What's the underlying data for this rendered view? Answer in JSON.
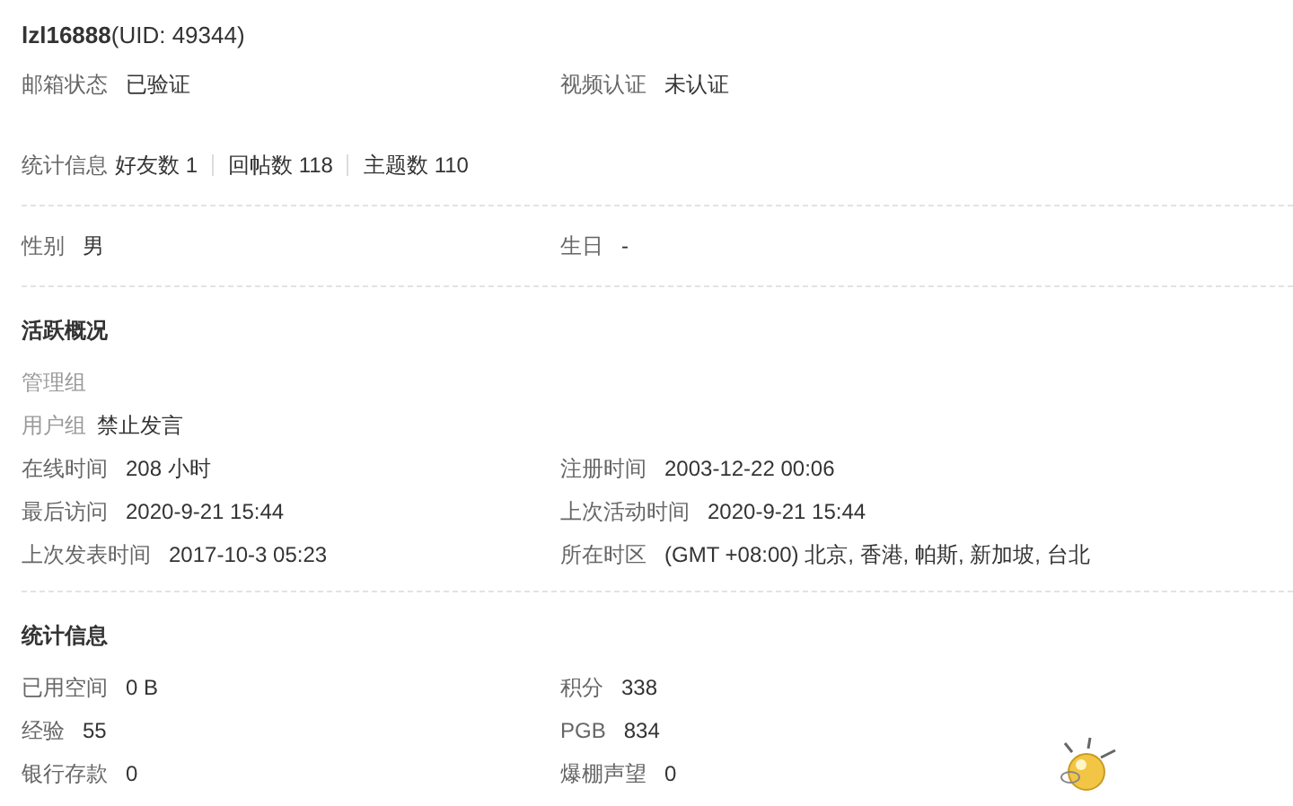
{
  "profile": {
    "username": "lzl16888",
    "uid": "(UID: 49344)"
  },
  "verification": [
    {
      "label": "邮箱状态",
      "value": "已验证"
    },
    {
      "label": "视频认证",
      "value": "未认证"
    }
  ],
  "stats_line": {
    "label": "统计信息",
    "items": [
      "好友数 1",
      "回帖数 118",
      "主题数 110"
    ]
  },
  "personal": [
    {
      "label": "性别",
      "value": "男"
    },
    {
      "label": "生日",
      "value": "-"
    }
  ],
  "activity": {
    "title": "活跃概况",
    "groups": [
      {
        "label": "管理组"
      },
      {
        "label": "用户组",
        "value": "禁止发言"
      }
    ],
    "fields": [
      {
        "label": "在线时间",
        "value": "208 小时"
      },
      {
        "label": "注册时间",
        "value": "2003-12-22 00:06"
      },
      {
        "label": "最后访问",
        "value": "2020-9-21 15:44"
      },
      {
        "label": "上次活动时间",
        "value": "2020-9-21 15:44"
      },
      {
        "label": "上次发表时间",
        "value": "2017-10-3 05:23"
      },
      {
        "label": "所在时区",
        "value": "(GMT +08:00) 北京, 香港, 帕斯, 新加坡, 台北"
      }
    ]
  },
  "statistics": {
    "title": "统计信息",
    "fields": [
      {
        "label": "已用空间",
        "value": "0 B"
      },
      {
        "label": "积分",
        "value": "338"
      },
      {
        "label": "经验",
        "value": "55"
      },
      {
        "label": "PGB",
        "value": "834"
      },
      {
        "label": "银行存款",
        "value": "0"
      },
      {
        "label": "爆棚声望",
        "value": "0"
      }
    ]
  }
}
